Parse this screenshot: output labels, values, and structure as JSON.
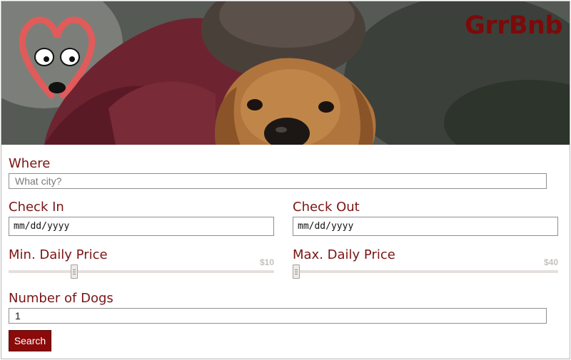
{
  "header": {
    "brand": "GrrBnb",
    "brand_color": "#7c0a0a",
    "logo_icon": "dog-heart-logo-icon",
    "hero_image": "person-hugging-dog-photo"
  },
  "form": {
    "where": {
      "label": "Where",
      "placeholder": "What city?",
      "value": ""
    },
    "check_in": {
      "label": "Check In",
      "value": "mm/dd/yyyy"
    },
    "check_out": {
      "label": "Check Out",
      "value": "mm/dd/yyyy"
    },
    "min_price": {
      "label": "Min. Daily Price",
      "value_text": "$10",
      "fraction": 0.24
    },
    "max_price": {
      "label": "Max. Daily Price",
      "value_text": "$40",
      "fraction": 0.0
    },
    "dogs": {
      "label": "Number of Dogs",
      "value": "1"
    },
    "search_label": "Search"
  },
  "colors": {
    "accent": "#7a1414",
    "button": "#8b0a0a",
    "slider_track": "#e5e0dc"
  }
}
